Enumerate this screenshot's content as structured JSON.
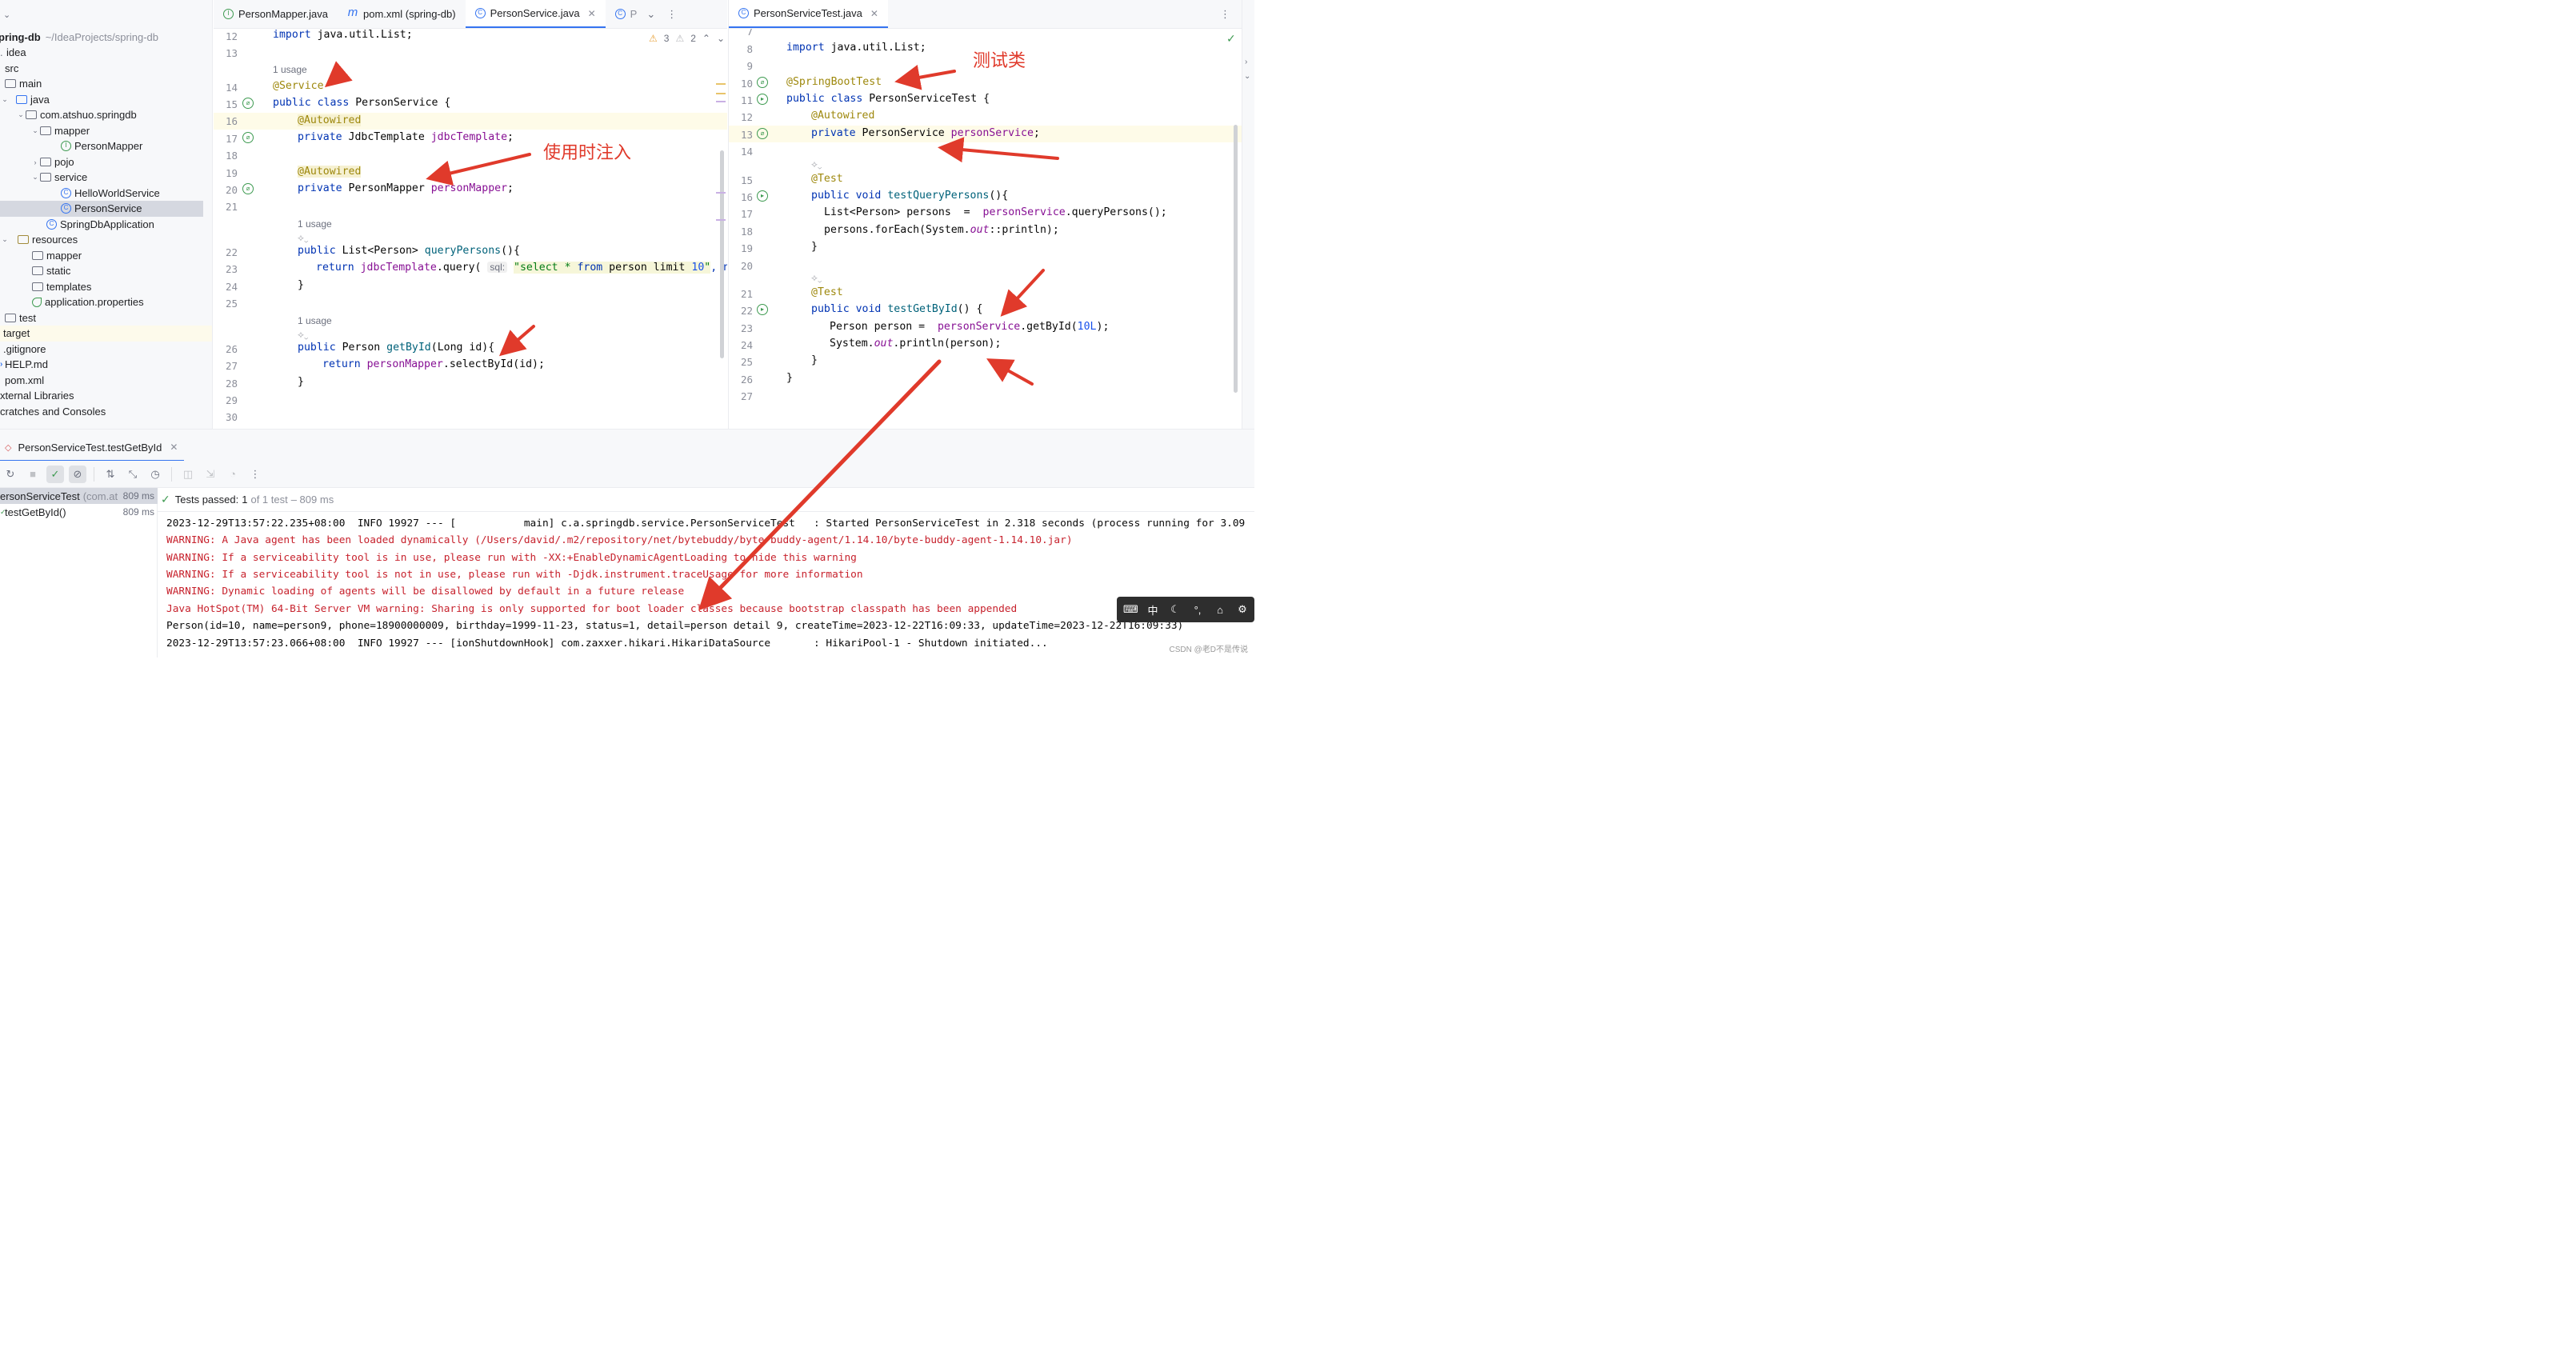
{
  "project_tree": {
    "root_name": "pring-db",
    "root_path": "~/IdeaProjects/spring-db",
    "items": [
      {
        "label": "idea"
      },
      {
        "label": "src"
      },
      {
        "label": "main"
      },
      {
        "label": "java"
      },
      {
        "label": "com.atshuo.springdb"
      },
      {
        "label": "mapper"
      },
      {
        "label": "PersonMapper"
      },
      {
        "label": "pojo"
      },
      {
        "label": "service"
      },
      {
        "label": "HelloWorldService"
      },
      {
        "label": "PersonService"
      },
      {
        "label": "SpringDbApplication"
      },
      {
        "label": "resources"
      },
      {
        "label": "mapper"
      },
      {
        "label": "static"
      },
      {
        "label": "templates"
      },
      {
        "label": "application.properties"
      },
      {
        "label": "test"
      },
      {
        "label": "target"
      },
      {
        "label": ".gitignore"
      },
      {
        "label": "HELP.md"
      },
      {
        "label": "pom.xml"
      },
      {
        "label": "xternal Libraries"
      },
      {
        "label": "cratches and Consoles"
      }
    ]
  },
  "left_editor": {
    "tabs": [
      {
        "label": "PersonMapper.java",
        "icon": "interface-icon"
      },
      {
        "label": "pom.xml (spring-db)",
        "icon": "maven-icon"
      },
      {
        "label": "PersonService.java",
        "icon": "class-icon",
        "active": true
      },
      {
        "label": "P",
        "icon": "class-icon"
      }
    ],
    "inspections": {
      "warnings": "3",
      "weak": "2"
    },
    "usage_hint": "1 usage",
    "sql_hint": "sql:",
    "lines": {
      "l12": "12",
      "l13": "13",
      "l14": "14",
      "l15": "15",
      "l16": "16",
      "l17": "17",
      "l18": "18",
      "l19": "19",
      "l20": "20",
      "l21": "21",
      "l22": "22",
      "l23": "23",
      "l24": "24",
      "l25": "25",
      "l26": "26",
      "l27": "27",
      "l28": "28",
      "l29": "29",
      "l30": "30"
    },
    "code": {
      "import_kw": "import",
      "import_rest": " java.util.List;",
      "service_ann": "@Service",
      "public": "public",
      "class": "class",
      "class_name": " PersonService {",
      "autowired": "@Autowired",
      "private": "private",
      "jdbc_type": " JdbcTemplate ",
      "jdbc_field": "jdbcTemplate",
      "semi": ";",
      "mapper_type": " PersonMapper ",
      "mapper_field": "personMapper",
      "qp_sig": " List<Person> ",
      "qp_name": "queryPersons",
      "qp_end": "(){",
      "return": "return",
      "jdbc_call": "jdbcTemplate",
      "query_call": ".query( ",
      "sql_q": "\"select * ",
      "sql_from": "from",
      "sql_rest": " person limit ",
      "sql_num": "10",
      "sql_end": "\"",
      "new_kw": ", new",
      "brace": "}",
      "gb_type": " Person ",
      "gb_name": "getById",
      "gb_args": "(Long id){",
      "gb_call": ".selectById(id);"
    }
  },
  "right_editor": {
    "tabs": [
      {
        "label": "PersonServiceTest.java",
        "icon": "class-icon",
        "active": true
      }
    ],
    "lines": {
      "l7": "7",
      "l8": "8",
      "l9": "9",
      "l10": "10",
      "l11": "11",
      "l12": "12",
      "l13": "13",
      "l14": "14",
      "l15": "15",
      "l16": "16",
      "l17": "17",
      "l18": "18",
      "l19": "19",
      "l20": "20",
      "l21": "21",
      "l22": "22",
      "l23": "23",
      "l24": "24",
      "l25": "25",
      "l26": "26",
      "l27": "27"
    },
    "code": {
      "import_kw": "import",
      "import_rest": " java.util.List;",
      "sbt": "@SpringBootTest",
      "public": "public",
      "class": "class",
      "class_name": " PersonServiceTest {",
      "autowired": "@Autowired",
      "private": "private",
      "ps_type": " PersonService ",
      "ps_field": "personService",
      "semi": ";",
      "test_ann": "@Test",
      "void": "void",
      "tq_name": "testQueryPersons",
      "tq_end": "(){",
      "list_decl": "List<Person> persons  =  ",
      "ps_call": "personService",
      "qp_call": ".queryPersons();",
      "foreach": "persons.forEach(System.",
      "out": "out",
      "println_ref": "::println);",
      "brace": "}",
      "tg_name": "testGetById",
      "tg_end": "() {",
      "person_decl": "Person person =  ",
      "getbyid_call": ".getById(",
      "num": "10L",
      "close": ");",
      "sys": "System.",
      "println": ".println(person);"
    }
  },
  "annotations": {
    "test_class": "测试类",
    "inject_on_use": "使用时注入"
  },
  "run_panel": {
    "tab_label": "PersonServiceTest.testGetById",
    "tree": [
      {
        "label": "ersonServiceTest",
        "detail": "(com.at",
        "time": "809 ms"
      },
      {
        "label": "testGetById()",
        "time": "809 ms"
      }
    ],
    "status": {
      "passed": "Tests passed:",
      "count": "1",
      "of_total": "of 1 test",
      "time": "– 809 ms"
    },
    "console": [
      {
        "text": "2023-12-29T13:57:22.235+08:00  INFO 19927 --- [           main] c.a.springdb.service.PersonServiceTest   : Started PersonServiceTest in 2.318 seconds (process running for 3.09",
        "err": false
      },
      {
        "text": "WARNING: A Java agent has been loaded dynamically (/Users/david/.m2/repository/net/bytebuddy/byte-buddy-agent/1.14.10/byte-buddy-agent-1.14.10.jar)",
        "err": true
      },
      {
        "text": "WARNING: If a serviceability tool is in use, please run with -XX:+EnableDynamicAgentLoading to hide this warning",
        "err": true
      },
      {
        "text": "WARNING: If a serviceability tool is not in use, please run with -Djdk.instrument.traceUsage for more information",
        "err": true
      },
      {
        "text": "WARNING: Dynamic loading of agents will be disallowed by default in a future release",
        "err": true
      },
      {
        "text": "Java HotSpot(TM) 64-Bit Server VM warning: Sharing is only supported for boot loader classes because bootstrap classpath has been appended",
        "err": true
      },
      {
        "text": "Person(id=10, name=person9, phone=18900000009, birthday=1999-11-23, status=1, detail=person detail 9, createTime=2023-12-22T16:09:33, updateTime=2023-12-22T16:09:33)",
        "err": false
      },
      {
        "text": "2023-12-29T13:57:23.066+08:00  INFO 19927 --- [ionShutdownHook] com.zaxxer.hikari.HikariDataSource       : HikariPool-1 - Shutdown initiated...",
        "err": false
      }
    ]
  },
  "ime": {
    "lang": "中"
  },
  "watermark": "CSDN @老D不是传说",
  "colors": {
    "accent": "#3574f0",
    "annotation_red": "#e03a2b",
    "pass_green": "#3d9a50",
    "error_red": "#c7222d"
  }
}
